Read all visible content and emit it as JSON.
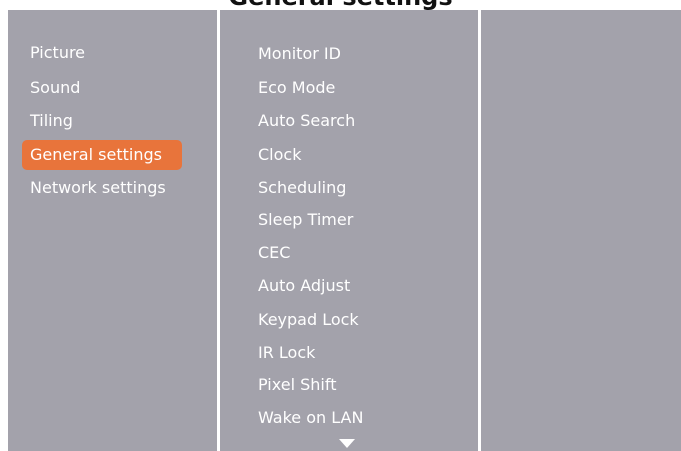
{
  "header": {
    "title": "General settings"
  },
  "left_menu": {
    "items": [
      {
        "label": "Picture"
      },
      {
        "label": "Sound"
      },
      {
        "label": "Tiling"
      },
      {
        "label": "General settings",
        "selected": true
      },
      {
        "label": "Network settings"
      }
    ]
  },
  "mid_menu": {
    "items": [
      {
        "label": "Monitor ID"
      },
      {
        "label": "Eco Mode"
      },
      {
        "label": "Auto Search"
      },
      {
        "label": "Clock"
      },
      {
        "label": "Scheduling"
      },
      {
        "label": "Sleep Timer"
      },
      {
        "label": "CEC"
      },
      {
        "label": "Auto Adjust"
      },
      {
        "label": "Keypad Lock"
      },
      {
        "label": "IR Lock"
      },
      {
        "label": "Pixel Shift"
      },
      {
        "label": "Wake on LAN"
      }
    ],
    "more_indicator": "chevron-down-icon"
  },
  "colors": {
    "panel_bg": "#a3a2ab",
    "highlight": "#e8743b",
    "text": "#ffffff"
  }
}
